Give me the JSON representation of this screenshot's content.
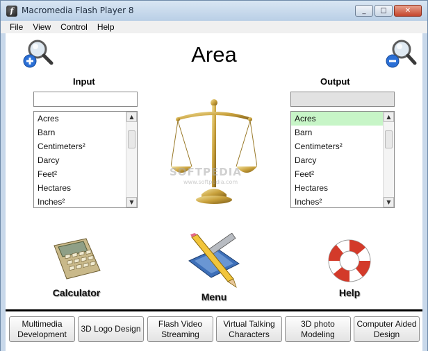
{
  "window": {
    "title": "Macromedia Flash Player 8",
    "minimize": "_",
    "maximize": "□",
    "close": "✕"
  },
  "menu": [
    "File",
    "View",
    "Control",
    "Help"
  ],
  "page": {
    "title": "Area"
  },
  "input": {
    "label": "Input",
    "value": "",
    "units": [
      "Acres",
      "Barn",
      "Centimeters²",
      "Darcy",
      "Feet²",
      "Hectares",
      "Inches²"
    ],
    "selected": null
  },
  "output": {
    "label": "Output",
    "value": "",
    "units": [
      "Acres",
      "Barn",
      "Centimeters²",
      "Darcy",
      "Feet²",
      "Hectares",
      "Inches²"
    ],
    "selected": "Acres"
  },
  "watermark": {
    "text": "SOFTPEDIA",
    "sub": "www.softpedia.com"
  },
  "tools": {
    "calculator": "Calculator",
    "menu": "Menu",
    "help": "Help"
  },
  "bottom_buttons": [
    "Multimedia Development",
    "3D Logo Design",
    "Flash Video Streaming",
    "Virtual Talking Characters",
    "3D photo Modeling",
    "Computer Aided Design"
  ],
  "colors": {
    "selected_row": "#c7f5c7",
    "zoom_in_badge": "#2a6fd6",
    "zoom_out_badge": "#2a6fd6"
  }
}
